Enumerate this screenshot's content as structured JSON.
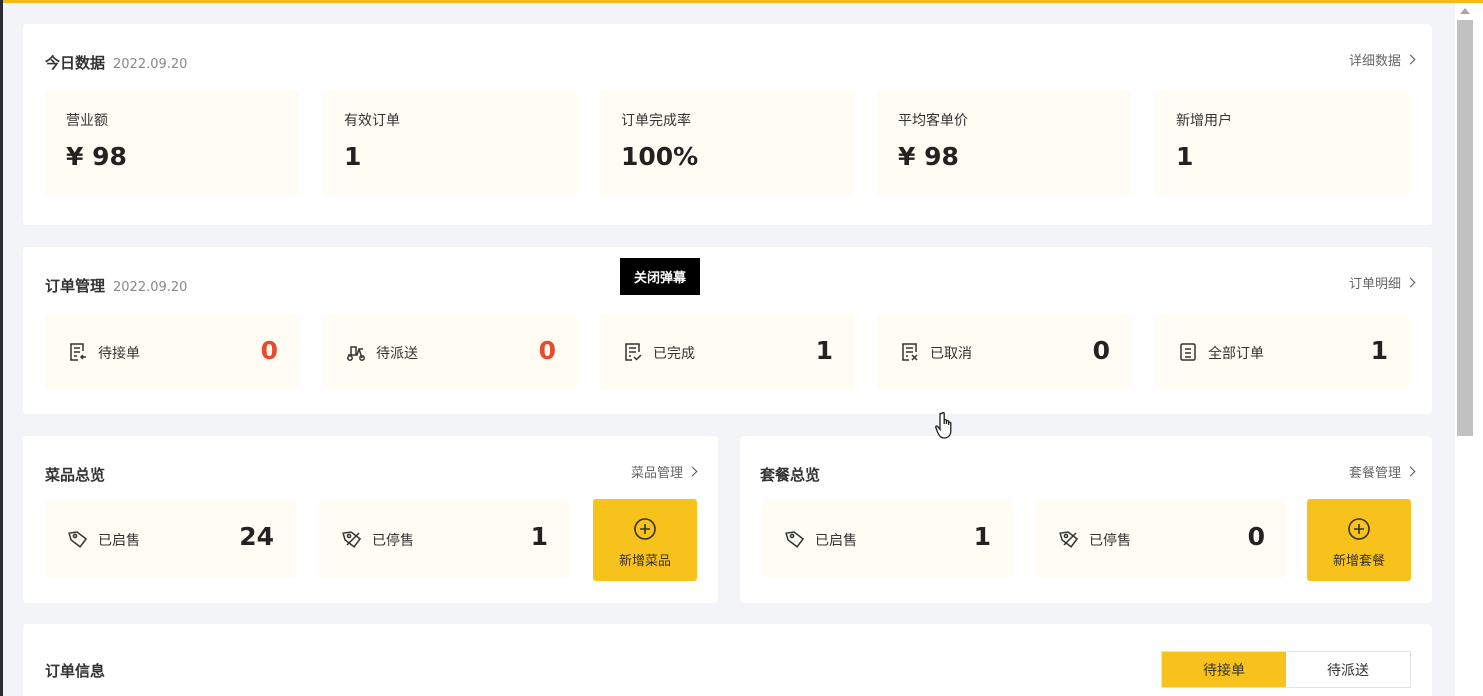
{
  "today": {
    "title": "今日数据",
    "date": "2022.09.20",
    "link": "详细数据",
    "stats": [
      {
        "label": "营业额",
        "value": "¥ 98"
      },
      {
        "label": "有效订单",
        "value": "1"
      },
      {
        "label": "订单完成率",
        "value": "100%"
      },
      {
        "label": "平均客单价",
        "value": "¥ 98"
      },
      {
        "label": "新增用户",
        "value": "1"
      }
    ]
  },
  "orders": {
    "title": "订单管理",
    "date": "2022.09.20",
    "link": "订单明细",
    "items": [
      {
        "label": "待接单",
        "value": "0"
      },
      {
        "label": "待派送",
        "value": "0"
      },
      {
        "label": "已完成",
        "value": "1"
      },
      {
        "label": "已取消",
        "value": "0"
      },
      {
        "label": "全部订单",
        "value": "1"
      }
    ]
  },
  "tooltip": "关闭弹幕",
  "dishes": {
    "title": "菜品总览",
    "link": "菜品管理",
    "on_sale": {
      "label": "已启售",
      "value": "24"
    },
    "off_sale": {
      "label": "已停售",
      "value": "1"
    },
    "add_label": "新增菜品"
  },
  "combos": {
    "title": "套餐总览",
    "link": "套餐管理",
    "on_sale": {
      "label": "已启售",
      "value": "1"
    },
    "off_sale": {
      "label": "已停售",
      "value": "0"
    },
    "add_label": "新增套餐"
  },
  "order_info": {
    "title": "订单信息",
    "tabs": [
      "待接单",
      "待派送"
    ]
  },
  "colors": {
    "accent": "#f8c21c",
    "alert": "#e84a2f"
  }
}
